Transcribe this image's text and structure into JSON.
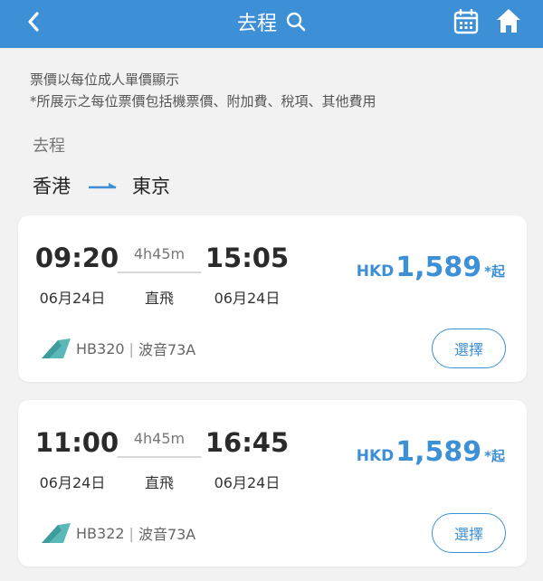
{
  "header": {
    "title": "去程",
    "back_icon": "chevron-left-icon",
    "search_icon": "search-icon",
    "calendar_icon": "calendar-icon",
    "home_icon": "home-icon",
    "bg_color": "#3d8fd6"
  },
  "notice": {
    "line1": "票價以每位成人單價顯示",
    "line2": "*所展示之每位票價包括機票價、附加費、稅項、其他費用"
  },
  "section_label": "去程",
  "route": {
    "origin": "香港",
    "destination": "東京"
  },
  "flights": [
    {
      "dep_time": "09:20",
      "arr_time": "15:05",
      "duration": "4h45m",
      "dep_date": "06月24日",
      "arr_date": "06月24日",
      "stops": "直飛",
      "currency": "HKD",
      "price": "1,589",
      "price_suffix": "*起",
      "flight_no": "HB320",
      "aircraft": "波音73A",
      "select_label": "選擇"
    },
    {
      "dep_time": "11:00",
      "arr_time": "16:45",
      "duration": "4h45m",
      "dep_date": "06月24日",
      "arr_date": "06月24日",
      "stops": "直飛",
      "currency": "HKD",
      "price": "1,589",
      "price_suffix": "*起",
      "flight_no": "HB322",
      "aircraft": "波音73A",
      "select_label": "選擇"
    }
  ],
  "colors": {
    "accent": "#3d8fd6",
    "logo": "#5bb8b8"
  }
}
